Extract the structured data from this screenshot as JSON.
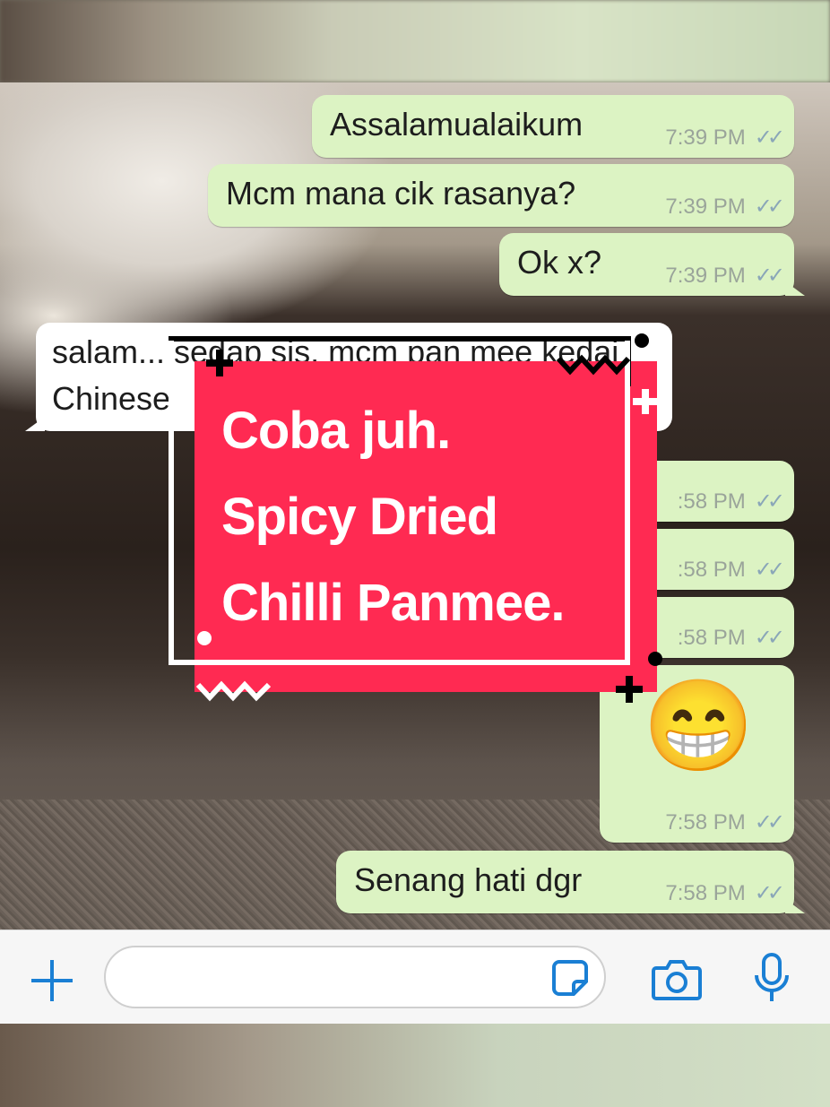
{
  "chat": {
    "messages": [
      {
        "direction": "out",
        "text": "Assalamualaikum",
        "time": "7:39 PM"
      },
      {
        "direction": "out",
        "text": "Mcm mana cik rasanya?",
        "time": "7:39 PM"
      },
      {
        "direction": "out",
        "text": "Ok x?",
        "time": "7:39 PM"
      },
      {
        "direction": "in",
        "text_line1": "salam... sedap sis, mcm pan mee kedai",
        "text_line2": "Chinese"
      },
      {
        "direction": "out",
        "time": ":58 PM"
      },
      {
        "direction": "out",
        "time": ":58 PM"
      },
      {
        "direction": "out",
        "time": ":58 PM"
      },
      {
        "direction": "out",
        "emoji": "😁",
        "time": "7:58 PM"
      },
      {
        "direction": "out",
        "text": "Senang hati dgr",
        "time": "7:58 PM"
      }
    ],
    "read_ticks": "✓✓"
  },
  "overlay": {
    "lines": [
      "Coba juh.",
      "Spicy Dried",
      "Chilli Panmee."
    ],
    "background_color": "#ff2a52",
    "text_color": "#ffffff"
  },
  "input_bar": {
    "placeholder": "",
    "icons": [
      "plus-icon",
      "sticker-icon",
      "camera-icon",
      "microphone-icon"
    ],
    "icon_color": "#1a7fd4"
  }
}
